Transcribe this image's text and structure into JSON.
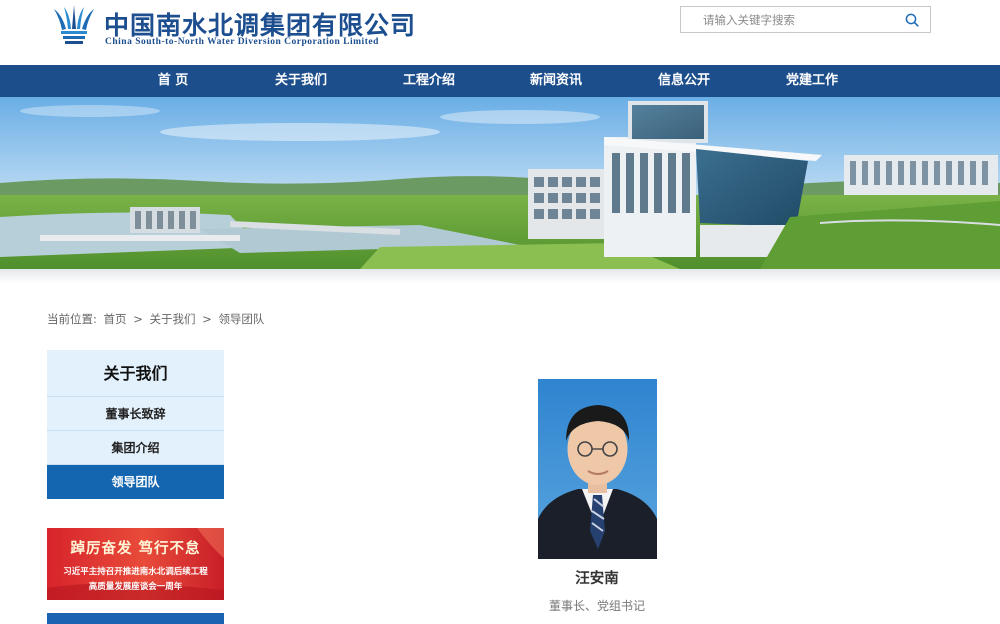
{
  "header": {
    "logo_cn": "中国南水北调集团有限公司",
    "logo_en": "China South-to-North Water Diversion Corporation Limited",
    "brand_color": "#1d4e8f"
  },
  "search": {
    "placeholder": "请输入关键字搜索",
    "icon": "search-icon"
  },
  "nav": {
    "items": [
      {
        "label": "首 页"
      },
      {
        "label": "关于我们"
      },
      {
        "label": "工程介绍"
      },
      {
        "label": "新闻资讯"
      },
      {
        "label": "信息公开"
      },
      {
        "label": "党建工作"
      }
    ],
    "color": "#1d4e8c"
  },
  "breadcrumb": {
    "prefix": "当前位置:",
    "items": [
      "首页",
      "关于我们",
      "领导团队"
    ],
    "separator": ">"
  },
  "sidebar": {
    "title": "关于我们",
    "items": [
      {
        "label": "董事长致辞",
        "active": false
      },
      {
        "label": "集团介绍",
        "active": false
      },
      {
        "label": "领导团队",
        "active": true
      }
    ],
    "active_color": "#1466b0"
  },
  "promo": {
    "title": "踔厉奋发 笃行不怠",
    "line1": "习近平主持召开推进南水北调后续工程",
    "line2": "高质量发展座谈会一周年"
  },
  "leader": {
    "name": "汪安南",
    "title": "董事长、党组书记"
  }
}
